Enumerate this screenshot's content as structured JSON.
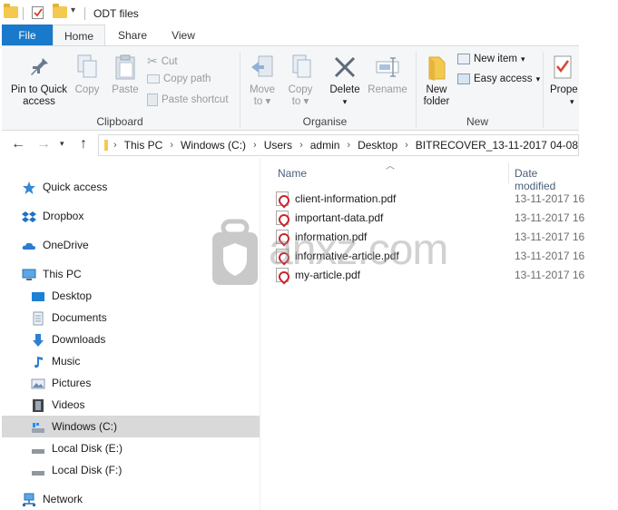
{
  "window": {
    "title": "ODT files"
  },
  "tabs": [
    {
      "label": "File"
    },
    {
      "label": "Home"
    },
    {
      "label": "Share"
    },
    {
      "label": "View"
    }
  ],
  "ribbon": {
    "clipboard": {
      "label": "Clipboard",
      "pin_label_1": "Pin to Quick",
      "pin_label_2": "access",
      "copy": "Copy",
      "paste": "Paste",
      "cut": "Cut",
      "copy_path": "Copy path",
      "paste_shortcut": "Paste shortcut"
    },
    "organise": {
      "label": "Organise",
      "move_to": "Move",
      "move_to_2": "to",
      "copy_to": "Copy",
      "copy_to_2": "to",
      "delete": "Delete",
      "rename": "Rename"
    },
    "new": {
      "label": "New",
      "new_folder_1": "New",
      "new_folder_2": "folder",
      "new_item": "New item",
      "easy_access": "Easy access"
    },
    "open": {
      "properties": "Prope"
    }
  },
  "address": {
    "crumbs": [
      "This PC",
      "Windows (C:)",
      "Users",
      "admin",
      "Desktop",
      "BITRECOVER_13-11-2017 04-08"
    ]
  },
  "nav_pane": {
    "items": [
      {
        "label": "Quick access",
        "icon": "star-icon"
      },
      {
        "label": "Dropbox",
        "icon": "dropbox-icon"
      },
      {
        "label": "OneDrive",
        "icon": "cloud-icon"
      },
      {
        "label": "This PC",
        "icon": "computer-icon"
      },
      {
        "label": "Desktop",
        "icon": "desktop-icon"
      },
      {
        "label": "Documents",
        "icon": "documents-icon"
      },
      {
        "label": "Downloads",
        "icon": "download-arrow-icon"
      },
      {
        "label": "Music",
        "icon": "music-note-icon"
      },
      {
        "label": "Pictures",
        "icon": "pictures-icon"
      },
      {
        "label": "Videos",
        "icon": "film-icon"
      },
      {
        "label": "Windows (C:)",
        "icon": "drive-c-icon",
        "selected": true
      },
      {
        "label": "Local Disk (E:)",
        "icon": "disk-icon"
      },
      {
        "label": "Local Disk (F:)",
        "icon": "disk-icon"
      },
      {
        "label": "Network",
        "icon": "network-icon"
      }
    ]
  },
  "file_list": {
    "columns": [
      "Name",
      "Date modified"
    ],
    "files": [
      {
        "name": "client-information.pdf",
        "date": "13-11-2017 16"
      },
      {
        "name": "important-data.pdf",
        "date": "13-11-2017 16"
      },
      {
        "name": "information.pdf",
        "date": "13-11-2017 16"
      },
      {
        "name": "informative-article.pdf",
        "date": "13-11-2017 16"
      },
      {
        "name": "my-article.pdf",
        "date": "13-11-2017 16"
      }
    ]
  },
  "watermark": {
    "text": "anxz.com"
  },
  "colors": {
    "file_tab": "#1979ca",
    "selected_item": "#d9d9d9",
    "ribbon_bg": "#f5f6f7",
    "column_header": "#4c607a",
    "folder": "#f4c94f"
  }
}
